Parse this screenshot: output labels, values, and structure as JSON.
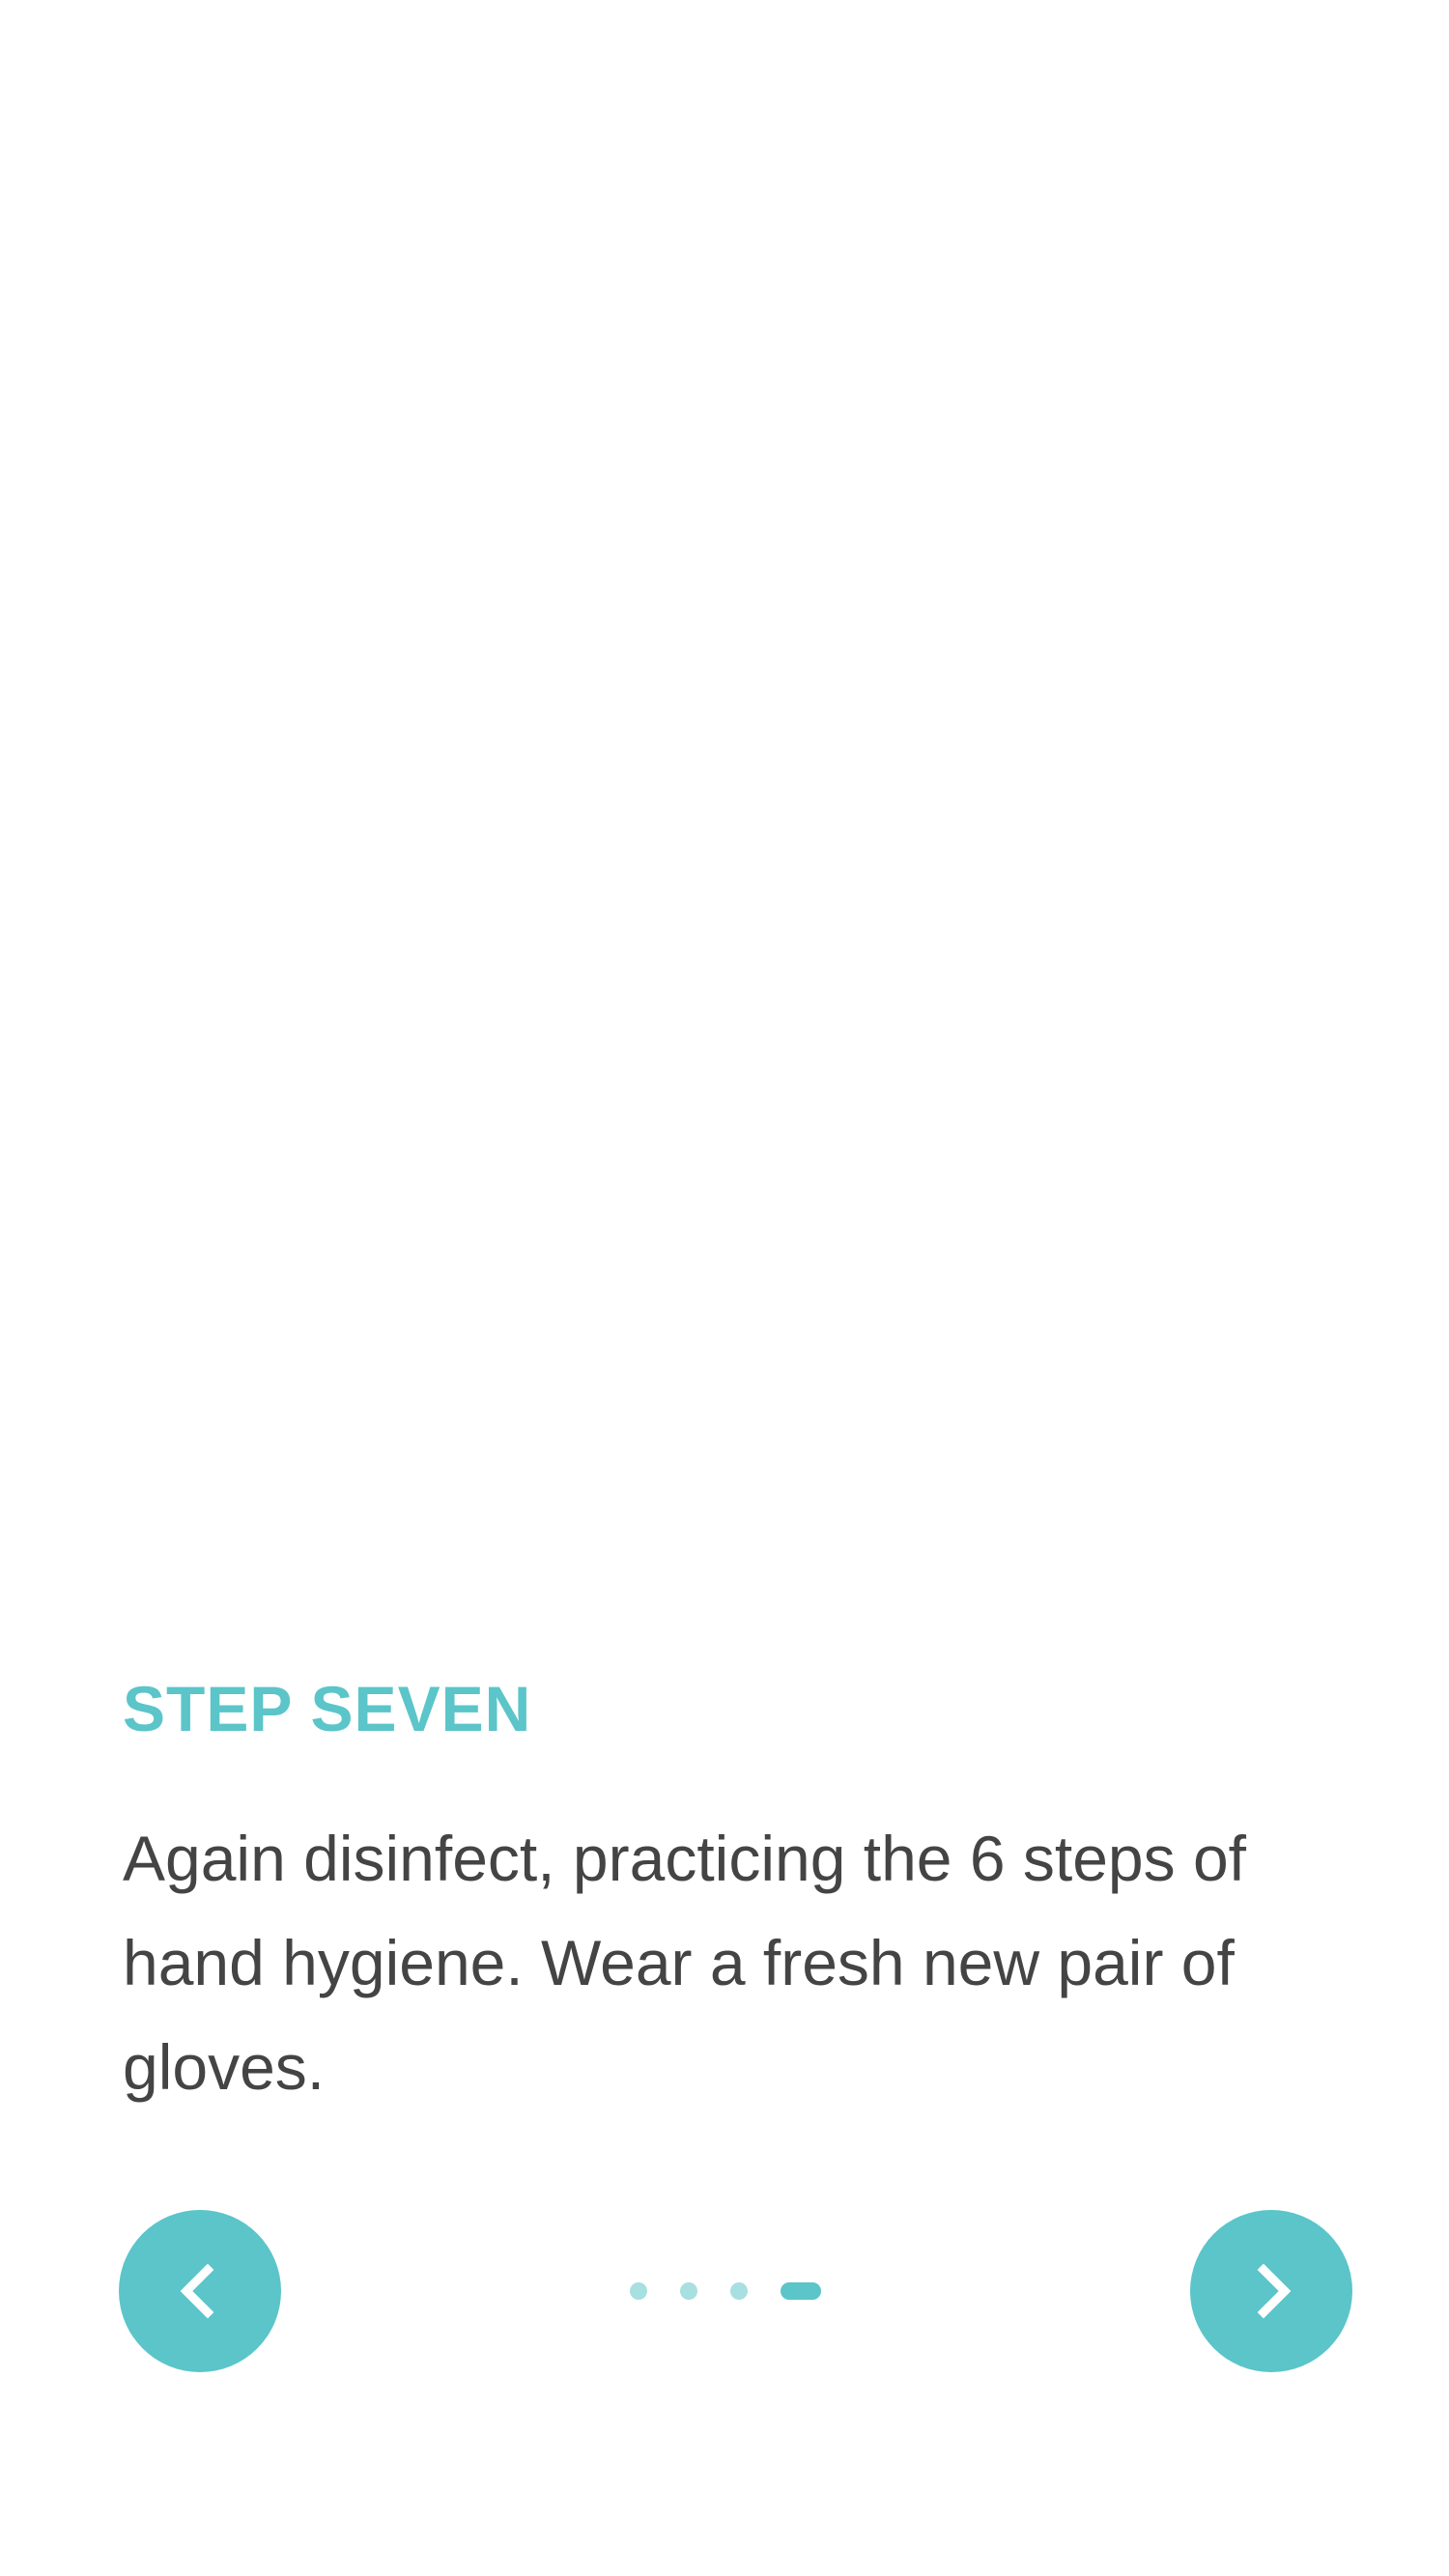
{
  "step": {
    "title": "STEP SEVEN",
    "description": "Again disinfect, practicing the 6 steps of hand hygiene. Wear a fresh new pair of gloves."
  },
  "navigation": {
    "prev_icon": "chevron-left-icon",
    "next_icon": "chevron-right-icon"
  },
  "pagination": {
    "total_dots": 4,
    "active_index": 3
  },
  "colors": {
    "accent": "#5bc5c9",
    "accent_light": "#a8dfe1",
    "text": "#444444",
    "background": "#ffffff"
  }
}
